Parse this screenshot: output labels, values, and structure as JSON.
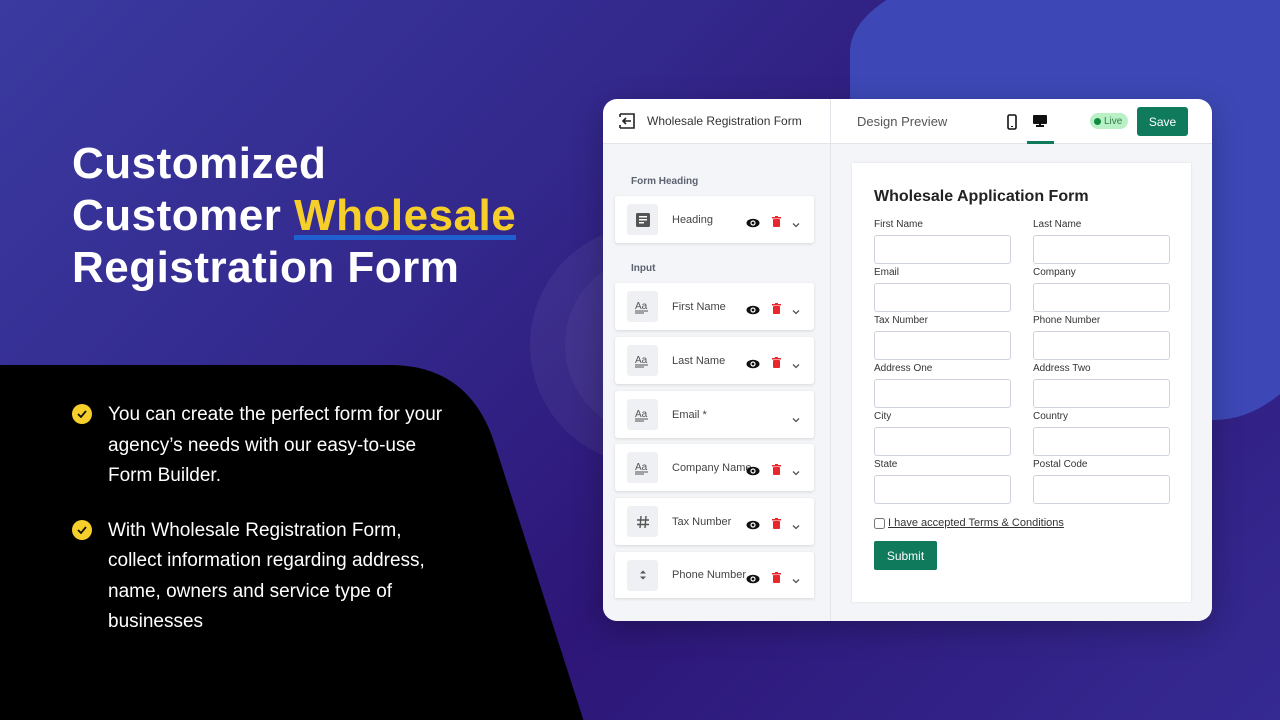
{
  "hero": {
    "line1": "Customized",
    "line2_prefix": "Customer ",
    "line2_highlight": "Wholesale",
    "line3": "Registration Form",
    "highlight_color": "#f7cf2b"
  },
  "bullets": [
    {
      "icon": "check-circle-icon",
      "text": "You can create the perfect form for your agency’s needs with our easy-to-use Form Builder."
    },
    {
      "icon": "check-circle-icon",
      "text": "With Wholesale Registration Form, collect information regarding address, name, owners and service type of businesses"
    }
  ],
  "app": {
    "title": "Wholesale Registration Form",
    "preview_tab": "Design Preview",
    "devices": [
      {
        "name": "mobile",
        "icon": "mobile-icon",
        "active": false
      },
      {
        "name": "desktop",
        "icon": "desktop-icon",
        "active": true
      }
    ],
    "status": "Live",
    "save_label": "Save",
    "accent_color": "#0f7b5c"
  },
  "sidebar": {
    "sections": [
      {
        "label": "Form Heading",
        "fields": [
          {
            "label": "Heading",
            "icon": "heading-icon",
            "visible_toggle": true,
            "deletable": true
          }
        ]
      },
      {
        "label": "Input",
        "fields": [
          {
            "label": "First Name",
            "icon": "text-field-icon",
            "visible_toggle": true,
            "deletable": true
          },
          {
            "label": "Last Name",
            "icon": "text-field-icon",
            "visible_toggle": true,
            "deletable": true
          },
          {
            "label": "Email *",
            "icon": "text-field-icon",
            "visible_toggle": false,
            "deletable": false
          },
          {
            "label": "Company Name",
            "icon": "text-field-icon",
            "visible_toggle": true,
            "deletable": true
          },
          {
            "label": "Tax Number",
            "icon": "hash-icon",
            "visible_toggle": true,
            "deletable": true
          },
          {
            "label": "Phone Number",
            "icon": "sort-icon",
            "visible_toggle": true,
            "deletable": true
          }
        ]
      }
    ]
  },
  "form": {
    "title": "Wholesale Application Form",
    "fields": [
      {
        "label": "First Name",
        "value": "",
        "placeholder": ""
      },
      {
        "label": "Last Name",
        "value": "",
        "placeholder": ""
      },
      {
        "label": "Email",
        "value": "",
        "placeholder": ""
      },
      {
        "label": "Company",
        "value": "",
        "placeholder": ""
      },
      {
        "label": "Tax Number",
        "value": "",
        "placeholder": ""
      },
      {
        "label": "Phone Number",
        "value": "",
        "placeholder": ""
      },
      {
        "label": "Address One",
        "value": "",
        "placeholder": ""
      },
      {
        "label": "Address Two",
        "value": "",
        "placeholder": ""
      },
      {
        "label": "City",
        "value": "",
        "placeholder": ""
      },
      {
        "label": "Country",
        "value": "",
        "placeholder": ""
      },
      {
        "label": "State",
        "value": "",
        "placeholder": ""
      },
      {
        "label": "Postal Code",
        "value": "",
        "placeholder": ""
      }
    ],
    "terms_label": "I have accepted Terms & Conditions",
    "terms_checked": false,
    "submit_label": "Submit"
  }
}
